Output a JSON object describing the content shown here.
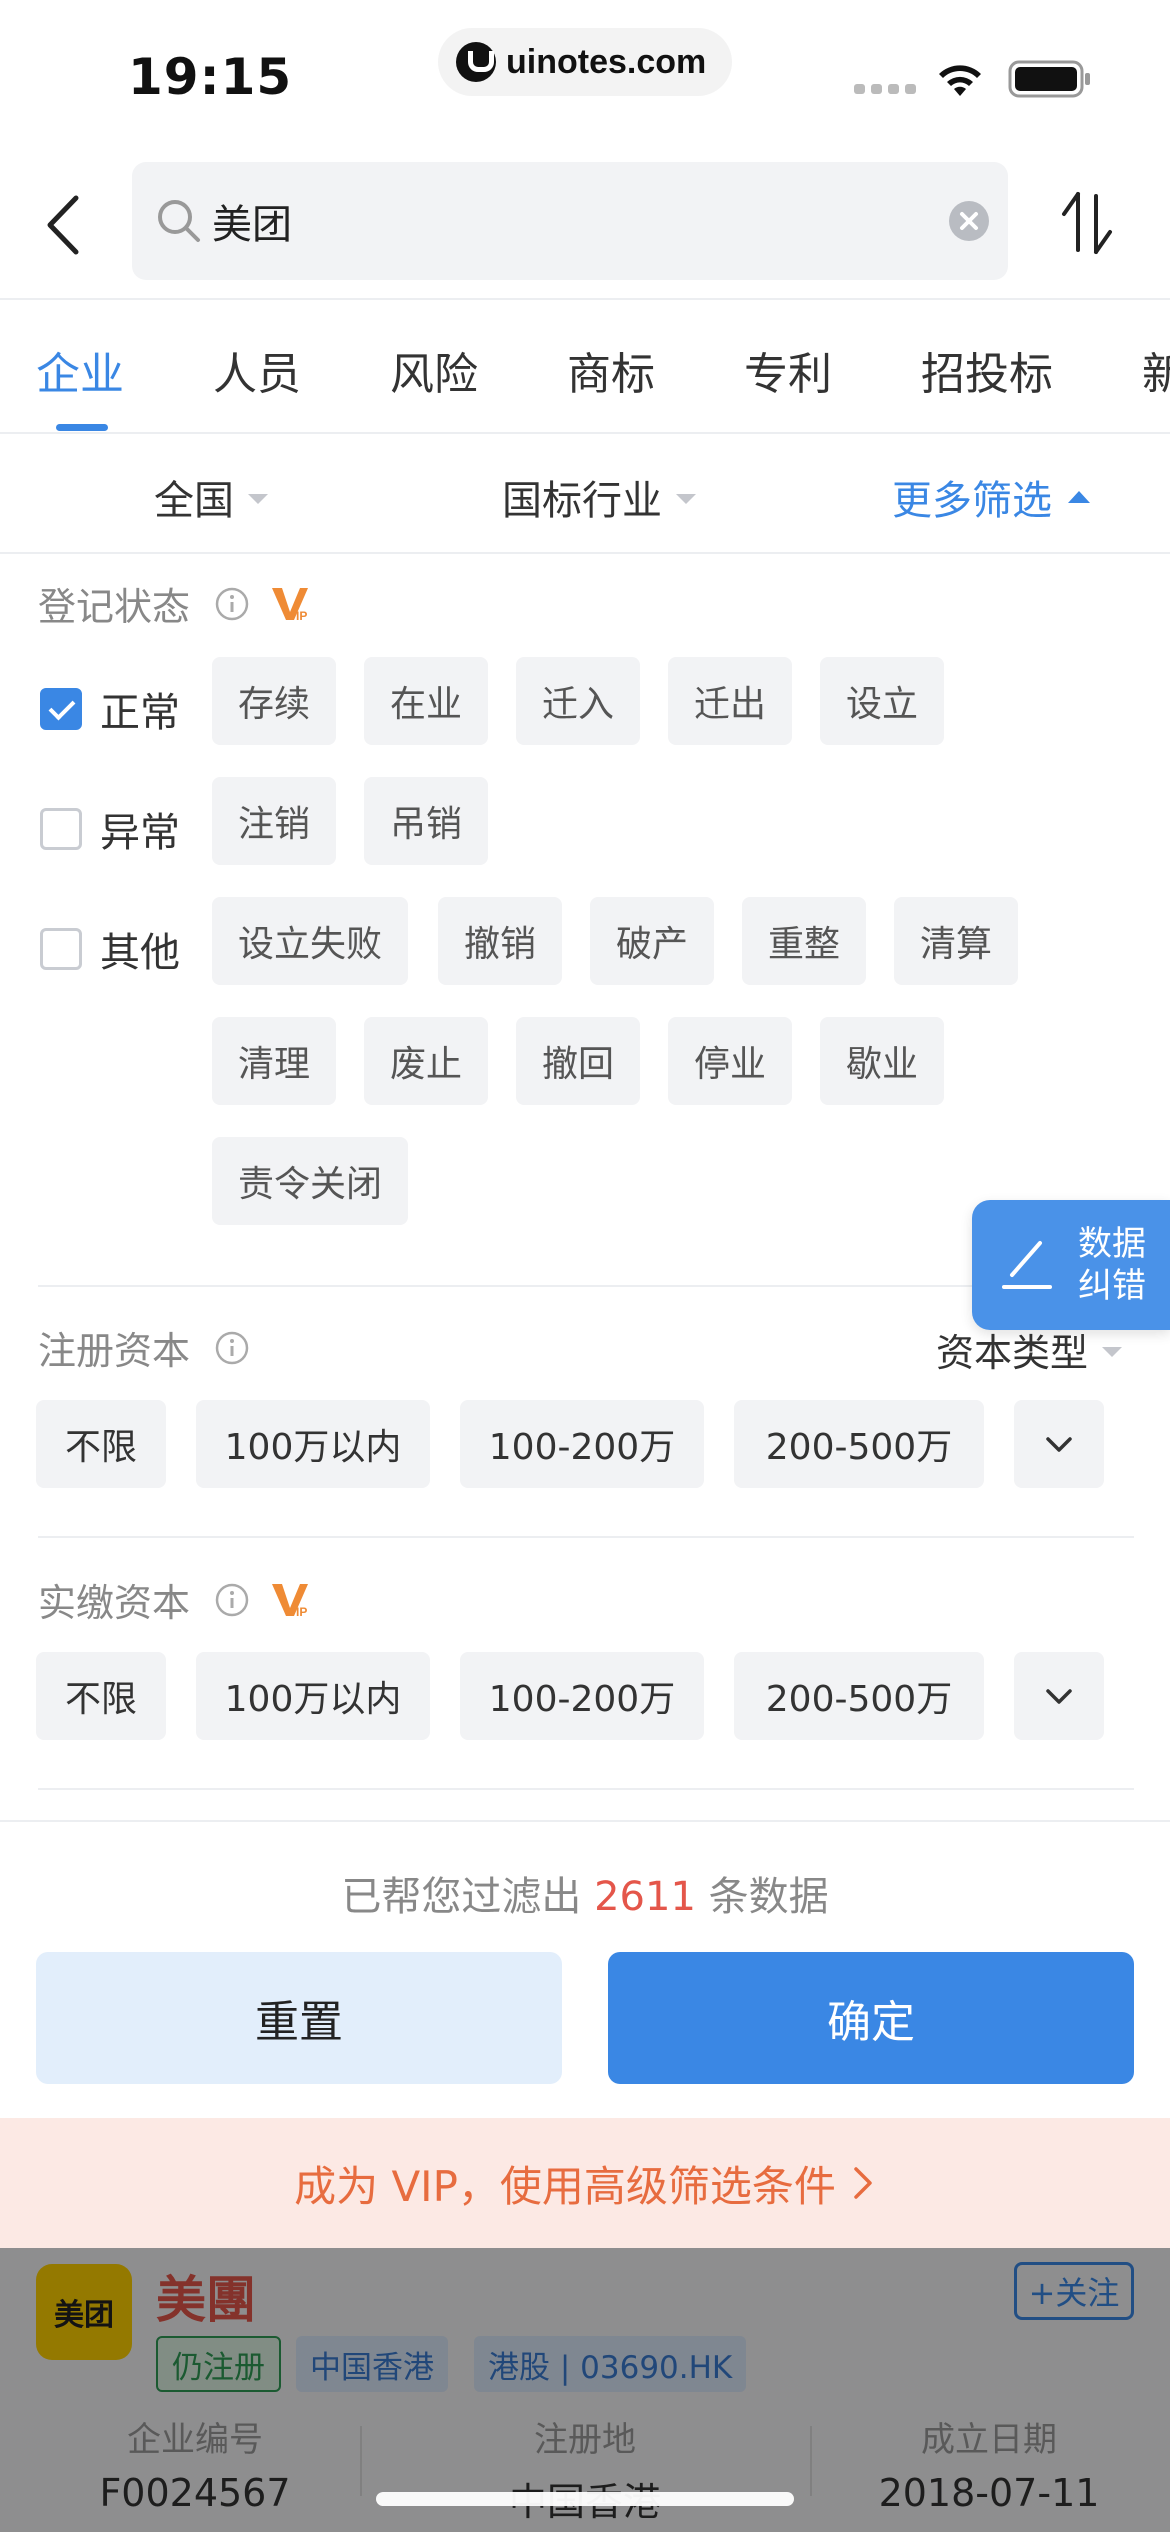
{
  "status_bar": {
    "time": "19:15",
    "url": "uinotes.com"
  },
  "search": {
    "value": "美团"
  },
  "tabs": [
    {
      "label": "企业",
      "active": true
    },
    {
      "label": "人员"
    },
    {
      "label": "风险"
    },
    {
      "label": "商标"
    },
    {
      "label": "专利"
    },
    {
      "label": "招投标"
    },
    {
      "label": "新"
    }
  ],
  "filters": {
    "region": "全国",
    "industry": "国标行业",
    "more": "更多筛选"
  },
  "registration_status": {
    "title": "登记状态",
    "rows": [
      {
        "label": "正常",
        "checked": true,
        "chips": [
          "存续",
          "在业",
          "迁入",
          "迁出",
          "设立"
        ]
      },
      {
        "label": "异常",
        "checked": false,
        "chips": [
          "注销",
          "吊销"
        ]
      },
      {
        "label": "其他",
        "checked": false,
        "chips": [
          "设立失败",
          "撤销",
          "破产",
          "重整",
          "清算",
          "清理",
          "废止",
          "撤回",
          "停业",
          "歇业",
          "责令关闭"
        ]
      }
    ]
  },
  "registered_capital": {
    "title": "注册资本",
    "type_label": "资本类型",
    "options": [
      "不限",
      "100万以内",
      "100-200万",
      "200-500万"
    ]
  },
  "paid_capital": {
    "title": "实缴资本",
    "options": [
      "不限",
      "100万以内",
      "100-200万",
      "200-500万"
    ]
  },
  "float_button": {
    "label": "数据纠错"
  },
  "summary": {
    "prefix": "已帮您过滤出",
    "count": "2611",
    "suffix": "条数据",
    "reset": "重置",
    "confirm": "确定"
  },
  "vip_banner": {
    "text": "成为 VIP，使用高级筛选条件"
  },
  "company_card": {
    "logo_text": "美团",
    "name": "美團",
    "follow": "+关注",
    "tags": [
      "仍注册",
      "中国香港",
      "港股 | 03690.HK"
    ],
    "info": [
      {
        "label": "企业编号",
        "value": "F0024567"
      },
      {
        "label": "注册地",
        "value": "中国香港"
      },
      {
        "label": "成立日期",
        "value": "2018-07-11"
      }
    ]
  },
  "colors": {
    "accent": "#3a87e4",
    "count_red": "#e4564a",
    "vip_orange": "#e76c3f"
  }
}
